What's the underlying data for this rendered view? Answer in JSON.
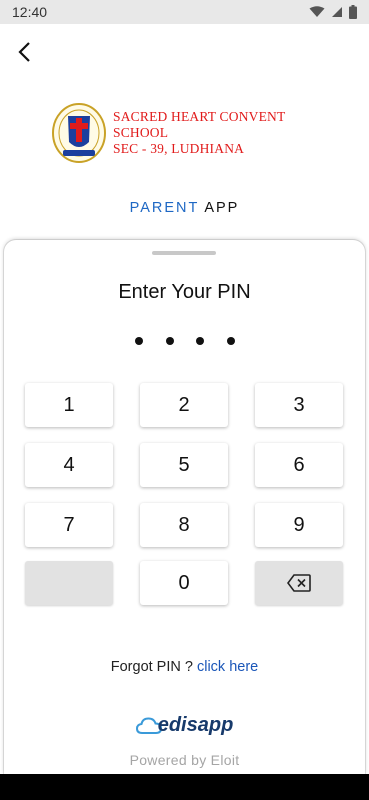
{
  "status": {
    "time": "12:40"
  },
  "school": {
    "name_line1": "SACRED HEART CONVENT SCHOOL",
    "name_line2": "SEC - 39, LUDHIANA"
  },
  "app": {
    "title_part1": "PARENT",
    "title_part2": "APP"
  },
  "pin": {
    "title": "Enter Your PIN",
    "entered_count": 4
  },
  "keypad": {
    "keys": [
      "1",
      "2",
      "3",
      "4",
      "5",
      "6",
      "7",
      "8",
      "9",
      "0"
    ]
  },
  "forgot": {
    "text": "Forgot PIN ?",
    "link": "click here"
  },
  "footer": {
    "brand": "edisapp",
    "powered": "Powered by Eloit"
  },
  "colors": {
    "school_red": "#e11b1b",
    "accent_blue": "#1e68c4",
    "link_blue": "#1a56b8"
  }
}
